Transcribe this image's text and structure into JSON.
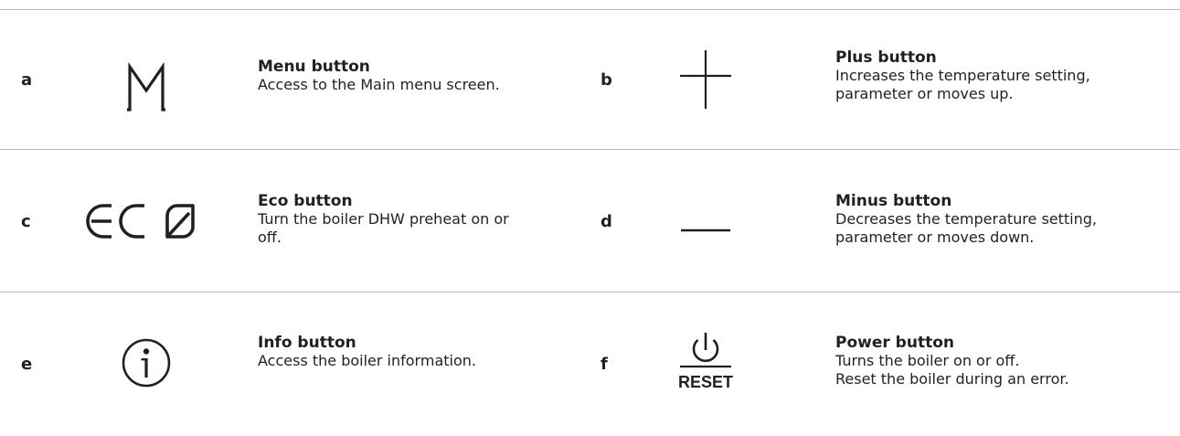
{
  "buttons": [
    {
      "letter": "a",
      "title": "Menu button",
      "description": "Access to the Main menu screen.",
      "icon": "menu-m-icon"
    },
    {
      "letter": "b",
      "title": "Plus button",
      "description": "Increases the temperature setting,\nparameter or moves up.",
      "icon": "plus-icon"
    },
    {
      "letter": "c",
      "title": "Eco button",
      "description": "Turn the boiler DHW preheat on or\noff.",
      "icon": "eco-icon"
    },
    {
      "letter": "d",
      "title": "Minus button",
      "description": "Decreases the temperature setting,\nparameter or moves down.",
      "icon": "minus-icon"
    },
    {
      "letter": "e",
      "title": "Info button",
      "description": "Access the boiler information.",
      "icon": "info-icon"
    },
    {
      "letter": "f",
      "title": "Power button",
      "description": "Turns the boiler on or off.\nReset the boiler during an error.",
      "icon": "power-reset-icon",
      "icon_label": "RESET"
    }
  ],
  "colors": {
    "text": "#231f20",
    "divider": "#b8b8b8"
  }
}
